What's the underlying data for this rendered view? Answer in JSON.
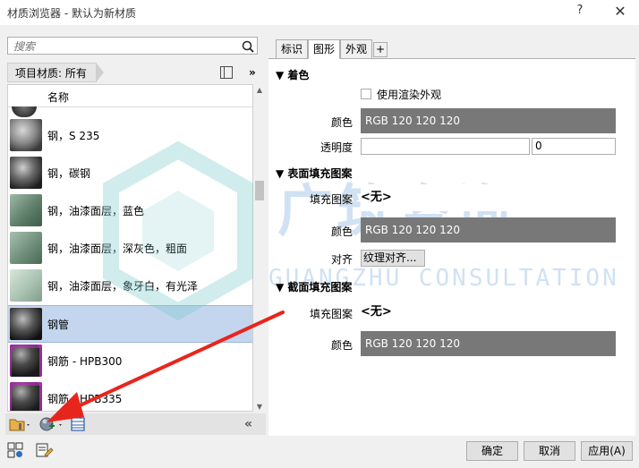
{
  "window": {
    "title": "材质浏览器 - 默认为新材质",
    "help": "?",
    "close": "✕"
  },
  "search": {
    "placeholder": "搜索"
  },
  "filter": {
    "label": "项目材质: 所有",
    "more": "»"
  },
  "list": {
    "header": "名称",
    "rows": [
      {
        "label": "钢，S 235",
        "thumb": "grey-sphere"
      },
      {
        "label": "钢，碳钢",
        "thumb": "dark-sphere"
      },
      {
        "label": "钢，油漆面层，蓝色",
        "thumb": "green-panel"
      },
      {
        "label": "钢，油漆面层，深灰色，粗面",
        "thumb": "green-panel"
      },
      {
        "label": "钢，油漆面层，象牙白，有光泽",
        "thumb": "light-panel"
      },
      {
        "label": "钢管",
        "thumb": "dark-sphere",
        "selected": true
      },
      {
        "label": "钢筋 - HPB300",
        "thumb": "purple-sphere"
      },
      {
        "label": "钢筋 - HPB335",
        "thumb": "purple-sphere"
      }
    ]
  },
  "left_toolbar": {
    "collapse": "«"
  },
  "tabs": [
    {
      "label": "标识"
    },
    {
      "label": "图形",
      "active": true
    },
    {
      "label": "外观"
    },
    {
      "label": "+"
    }
  ],
  "graphics": {
    "shading": {
      "title": "着色",
      "use_render_appearance": "使用渲染外观",
      "color_label": "颜色",
      "color_value": "RGB 120 120 120",
      "transparency_label": "透明度",
      "transparency_value": "0"
    },
    "surface": {
      "title": "表面填充图案",
      "pattern_label": "填充图案",
      "pattern_value": "<无>",
      "color_label": "颜色",
      "color_value": "RGB 120 120 120",
      "align_label": "对齐",
      "align_button": "纹理对齐..."
    },
    "cut": {
      "title": "截面填充图案",
      "pattern_label": "填充图案",
      "pattern_value": "<无>",
      "color_label": "颜色",
      "color_value": "RGB 120 120 120"
    }
  },
  "watermark": {
    "line1": "广筑咨询",
    "line2": "GUANGZHU CONSULTATION"
  },
  "footer": {
    "ok": "确定",
    "cancel": "取消",
    "apply": "应用(A)"
  },
  "colors": {
    "swatch": "#787878",
    "selection": "#c4d6ee",
    "arrow": "#e8251c"
  }
}
